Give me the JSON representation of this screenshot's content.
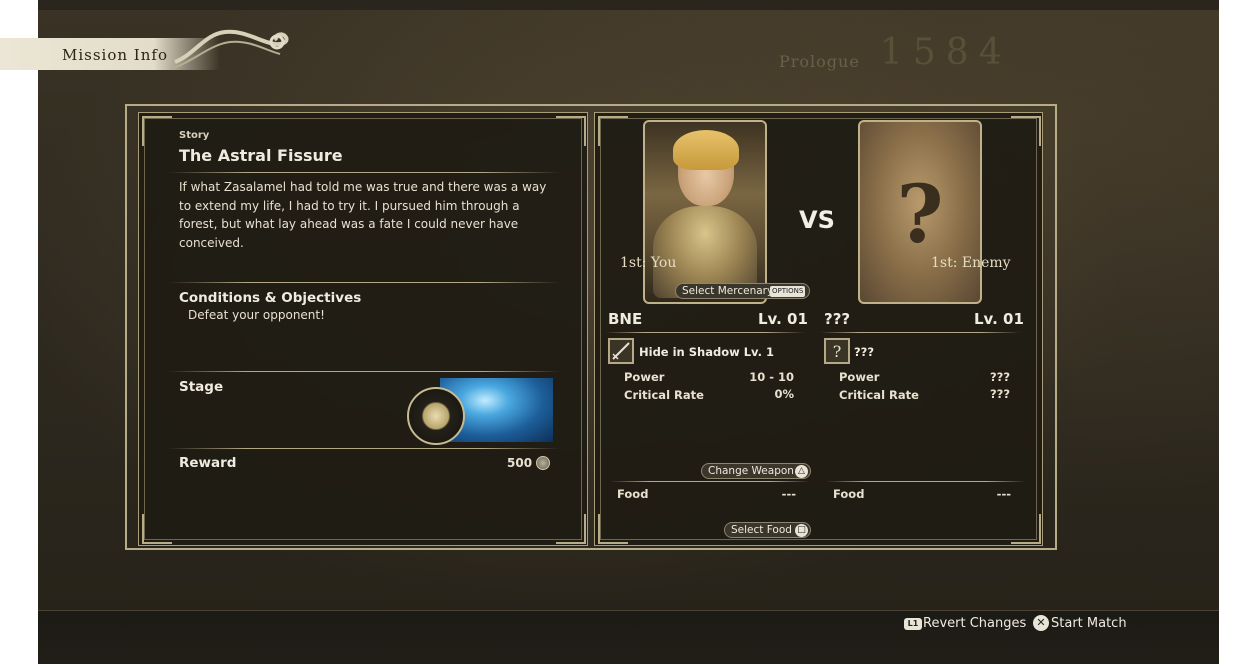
{
  "header": {
    "mission_info": "Mission Info",
    "chapter": "Prologue",
    "year": "1584"
  },
  "story": {
    "label": "Story",
    "title": "The Astral Fissure",
    "text": "If what Zasalamel had told me was true and there was a way to extend my life, I had to try it. I pursued him through a forest, but what lay ahead was a fate I could never have conceived."
  },
  "conditions": {
    "heading": "Conditions & Objectives",
    "objective": "Defeat your opponent!"
  },
  "stage": {
    "heading": "Stage"
  },
  "reward": {
    "heading": "Reward",
    "value": "500"
  },
  "vs_label": "VS",
  "player": {
    "rank": "1st: You",
    "name": "BNE",
    "level": "Lv. 01",
    "weapon": "Hide in Shadow Lv. 1",
    "power_label": "Power",
    "power": "10 - 10",
    "crit_label": "Critical Rate",
    "crit": "0%",
    "food_label": "Food",
    "food": "---"
  },
  "enemy": {
    "rank": "1st: Enemy",
    "name": "???",
    "level": "Lv. 01",
    "weapon": "???",
    "power_label": "Power",
    "power": "???",
    "crit_label": "Critical Rate",
    "crit": "???",
    "food_label": "Food",
    "food": "---",
    "card_symbol": "?"
  },
  "buttons": {
    "select_mercenary": "Select Mercenary",
    "options_tag": "OPTIONS",
    "change_weapon": "Change Weapon",
    "change_weapon_icon": "△",
    "select_food": "Select Food",
    "select_food_icon": "□",
    "revert_changes": "Revert Changes",
    "revert_icon": "L1",
    "start_match": "Start Match",
    "start_icon": "✕"
  },
  "icons": {
    "scroll": "scroll-ornament-icon",
    "coin": "coin-icon",
    "sword": "sword-icon",
    "unknown_weapon": "question-weapon-icon"
  },
  "colors": {
    "panel_border": "#b8ab88",
    "text": "#f0ebdf",
    "stage_water": "#4aa8e0"
  }
}
